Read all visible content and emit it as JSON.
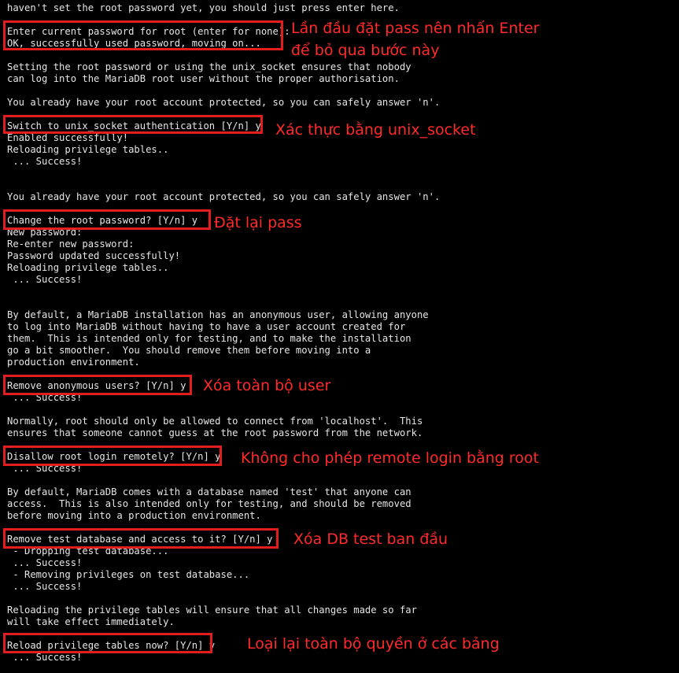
{
  "terminal": {
    "lines": [
      "haven't set the root password yet, you should just press enter here.",
      "",
      "Enter current password for root (enter for none):",
      "OK, successfully used password, moving on...",
      "",
      "Setting the root password or using the unix_socket ensures that nobody",
      "can log into the MariaDB root user without the proper authorisation.",
      "",
      "You already have your root account protected, so you can safely answer 'n'.",
      "",
      "Switch to unix_socket authentication [Y/n] y",
      "Enabled successfully!",
      "Reloading privilege tables..",
      " ... Success!",
      "",
      "",
      "You already have your root account protected, so you can safely answer 'n'.",
      "",
      "Change the root password? [Y/n] y",
      "New password:",
      "Re-enter new password:",
      "Password updated successfully!",
      "Reloading privilege tables..",
      " ... Success!",
      "",
      "",
      "By default, a MariaDB installation has an anonymous user, allowing anyone",
      "to log into MariaDB without having to have a user account created for",
      "them.  This is intended only for testing, and to make the installation",
      "go a bit smoother.  You should remove them before moving into a",
      "production environment.",
      "",
      "Remove anonymous users? [Y/n] y",
      " ... Success!",
      "",
      "Normally, root should only be allowed to connect from 'localhost'.  This",
      "ensures that someone cannot guess at the root password from the network.",
      "",
      "Disallow root login remotely? [Y/n] y",
      " ... Success!",
      "",
      "By default, MariaDB comes with a database named 'test' that anyone can",
      "access.  This is also intended only for testing, and should be removed",
      "before moving into a production environment.",
      "",
      "Remove test database and access to it? [Y/n] y",
      " - Dropping test database...",
      " ... Success!",
      " - Removing privileges on test database...",
      " ... Success!",
      "",
      "Reloading the privilege tables will ensure that all changes made so far",
      "will take effect immediately.",
      "",
      "Reload privilege tables now? [Y/n] y",
      " ... Success!"
    ]
  },
  "annotations": {
    "color": "#ff2a2a",
    "enter_password": "Lần đầu đặt pass nên nhấn Enter\nđể bỏ qua bước này",
    "unix_socket": "Xác thực bằng unix_socket",
    "change_password": "Đặt lại pass",
    "remove_anonymous": "Xóa toàn bộ user",
    "disallow_remote": "Không cho phép remote login bằng root",
    "remove_test_db": "Xóa DB test ban đầu",
    "reload_privileges": "Loại lại toàn bộ quyền ở các bảng"
  }
}
